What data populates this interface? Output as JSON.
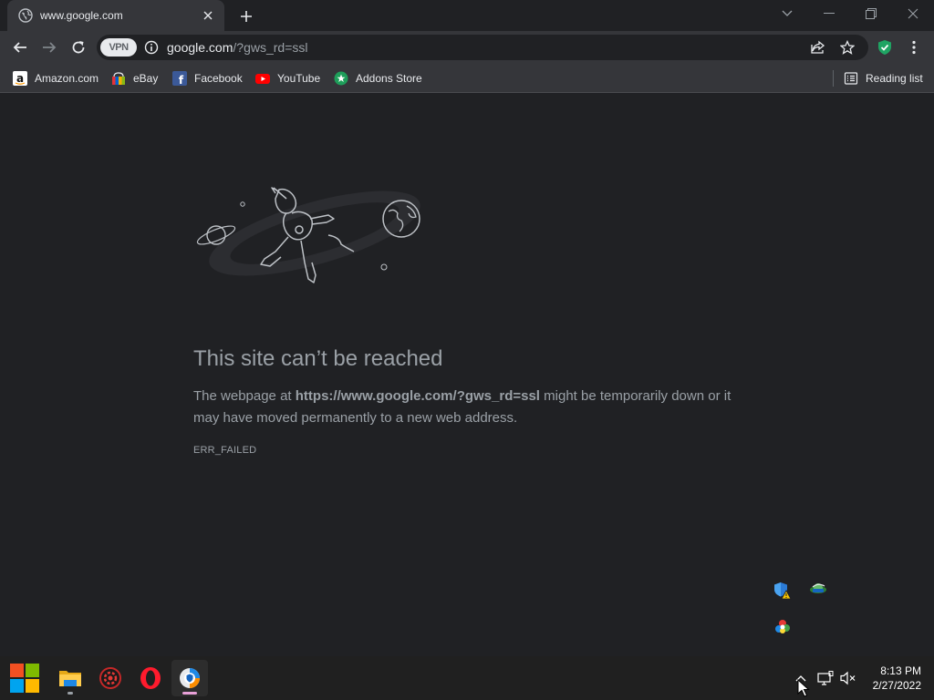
{
  "tab": {
    "title": "www.google.com"
  },
  "omnibox": {
    "vpn_label": "VPN",
    "host": "google.com",
    "path": "/?gws_rd=ssl"
  },
  "bookmarks": [
    {
      "label": "Amazon.com",
      "icon": "amazon-icon"
    },
    {
      "label": "eBay",
      "icon": "ebay-icon"
    },
    {
      "label": "Facebook",
      "icon": "facebook-icon"
    },
    {
      "label": "YouTube",
      "icon": "youtube-icon"
    },
    {
      "label": "Addons Store",
      "icon": "addons-store-icon"
    }
  ],
  "reading_list": {
    "label": "Reading list"
  },
  "error": {
    "title": "This site can’t be reached",
    "desc_prefix": "The webpage at ",
    "desc_url": "https://www.google.com/?gws_rd=ssl",
    "desc_suffix": " might be temporarily down or it may have moved permanently to a new web address.",
    "code": "ERR_FAILED"
  },
  "taskbar": {
    "apps": [
      "start-button",
      "file-explorer",
      "game-app",
      "opera-browser",
      "avast-secure-browser"
    ],
    "time": "8:13 PM",
    "date": "2/27/2022"
  },
  "colors": {
    "page_bg": "#202124",
    "toolbar_bg": "#35363a",
    "text_muted": "#9aa0a6",
    "taskbar_bg": "#202020"
  }
}
